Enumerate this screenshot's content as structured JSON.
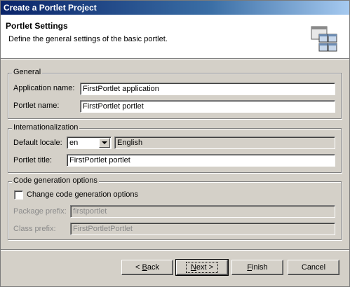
{
  "window": {
    "title": "Create a Portlet Project"
  },
  "header": {
    "title": "Portlet Settings",
    "description": "Define the general settings of the basic portlet.",
    "icon": "portlet-wizard-icon"
  },
  "general": {
    "legend": "General",
    "application_name_label": "Application name:",
    "application_name_value": "FirstPortlet application",
    "portlet_name_label": "Portlet name:",
    "portlet_name_value": "FirstPortlet portlet"
  },
  "internationalization": {
    "legend": "Internationalization",
    "default_locale_label": "Default locale:",
    "default_locale_value": "en",
    "locale_name_value": "English",
    "portlet_title_label": "Portlet title:",
    "portlet_title_value": "FirstPortlet portlet"
  },
  "code_generation": {
    "legend": "Code generation options",
    "change_options_label": "Change code generation options",
    "change_options_checked": false,
    "package_prefix_label": "Package prefix:",
    "package_prefix_value": "firstportlet",
    "class_prefix_label": "Class prefix:",
    "class_prefix_value": "FirstPortletPortlet"
  },
  "buttons": {
    "back_label": "< Back",
    "back_mnemonic": "B",
    "next_label": "Next >",
    "next_mnemonic": "N",
    "finish_label": "Finish",
    "finish_mnemonic": "F",
    "cancel_label": "Cancel"
  },
  "colors": {
    "dialog_bg": "#d4d0c8",
    "title_bar": "#0a246a",
    "header_bg": "#ffffff",
    "disabled_text": "#8a8a8a"
  }
}
